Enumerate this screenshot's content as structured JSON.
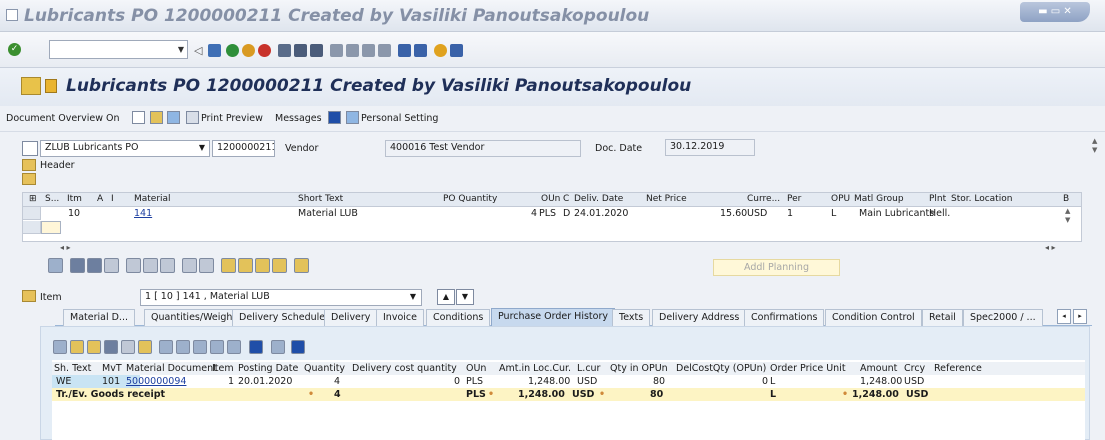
{
  "window": {
    "title": "Lubricants PO 1200000211 Created by Vasiliki Panoutsakopoulou",
    "controls": "▬ ▭ ✕"
  },
  "screen_title": "Lubricants PO 1200000211 Created by Vasiliki Panoutsakopoulou",
  "app_toolbar": {
    "doc_overview": "Document Overview On",
    "print_preview": "Print Preview",
    "messages": "Messages",
    "personal_setting": "Personal Setting"
  },
  "header": {
    "doc_type": "ZLUB Lubricants PO",
    "po_number": "1200000211",
    "vendor_label": "Vendor",
    "vendor_value": "400016 Test Vendor",
    "doc_date_label": "Doc. Date",
    "doc_date_value": "30.12.2019",
    "header_label": "Header"
  },
  "items_table": {
    "columns": [
      "S...",
      "Itm",
      "A",
      "I",
      "Material",
      "Short Text",
      "PO Quantity",
      "OUn",
      "C",
      "Deliv. Date",
      "Net Price",
      "Curre...",
      "Per",
      "OPU",
      "Matl Group",
      "Plnt",
      "Stor. Location",
      "B"
    ],
    "row": {
      "itm": "10",
      "material": "141",
      "short_text": "Material LUB",
      "po_quantity": "4",
      "oun": "PLS",
      "c": "D",
      "deliv_date": "24.01.2020",
      "net_price": "15.60",
      "currency": "USD",
      "per": "1",
      "opu": "L",
      "matl_group": "Main Lubricants",
      "plnt": "Hell."
    },
    "addl_planning": "Addl Planning"
  },
  "item_section": {
    "label": "Item",
    "selector": "1 [ 10 ] 141 , Material LUB"
  },
  "tabs": [
    {
      "label": "Material D..."
    },
    {
      "label": "Quantities/Weights"
    },
    {
      "label": "Delivery Schedule"
    },
    {
      "label": "Delivery"
    },
    {
      "label": "Invoice"
    },
    {
      "label": "Conditions"
    },
    {
      "label": "Purchase Order History"
    },
    {
      "label": "Texts"
    },
    {
      "label": "Delivery Address"
    },
    {
      "label": "Confirmations"
    },
    {
      "label": "Condition Control"
    },
    {
      "label": "Retail"
    },
    {
      "label": "Spec2000 / ..."
    }
  ],
  "history": {
    "columns": [
      "Sh. Text",
      "MvT",
      "Material Document",
      "Item",
      "Posting Date",
      "Quantity",
      "Delivery cost quantity",
      "OUn",
      "Amt.in Loc.Cur.",
      "L.cur",
      "Qty in OPUn",
      "DelCostQty (OPUn)",
      "Order Price Unit",
      "Amount",
      "Crcy",
      "Reference"
    ],
    "row": {
      "sh_text": "WE",
      "mvt": "101",
      "mat_doc": "5000000094",
      "item": "1",
      "posting_date": "20.01.2020",
      "quantity": "4",
      "del_cost_qty": "0",
      "oun": "PLS",
      "amt_loc": "1,248.00",
      "lcur": "USD",
      "qty_opun": "80",
      "delcost_opun": "0",
      "order_price_unit": "L",
      "amount": "1,248.00",
      "crcy": "USD"
    },
    "total": {
      "label": "Tr./Ev. Goods receipt",
      "quantity": "4",
      "oun": "PLS",
      "amt_loc": "1,248.00",
      "lcur": "USD",
      "qty_opun": "80",
      "order_price_unit": "L",
      "amount": "1,248.00",
      "crcy": "USD"
    }
  }
}
